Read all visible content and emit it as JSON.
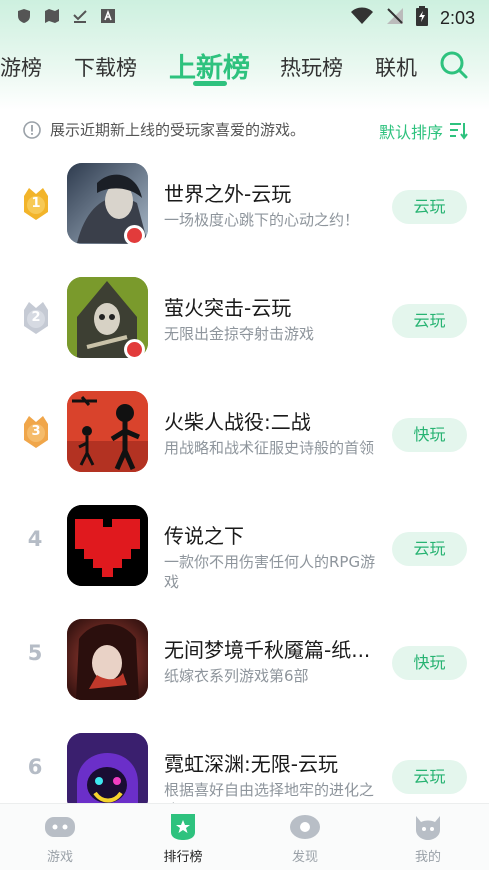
{
  "status_bar": {
    "time": "2:03"
  },
  "tabs": [
    {
      "label": "游榜"
    },
    {
      "label": "下载榜"
    },
    {
      "label": "上新榜"
    },
    {
      "label": "热玩榜"
    },
    {
      "label": "联机"
    }
  ],
  "notice": {
    "text": "展示近期新上线的受玩家喜爱的游戏。"
  },
  "sort": {
    "label": "默认排序"
  },
  "games": [
    {
      "rank": "1",
      "title": "世界之外-云玩",
      "desc": "一场极度心跳下的心动之约！",
      "action": "云玩"
    },
    {
      "rank": "2",
      "title": "萤火突击-云玩",
      "desc": "无限出金掠夺射击游戏",
      "action": "云玩"
    },
    {
      "rank": "3",
      "title": "火柴人战役:二战",
      "desc": "用战略和战术征服史诗般的首领",
      "action": "快玩"
    },
    {
      "rank": "4",
      "title": "传说之下",
      "desc": "一款你不用伤害任何人的RPG游戏",
      "action": "云玩"
    },
    {
      "rank": "5",
      "title": "无间梦境千秋魇篇-纸...",
      "desc": "纸嫁衣系列游戏第6部",
      "action": "快玩"
    },
    {
      "rank": "6",
      "title": "霓虹深渊:无限-云玩",
      "desc": "根据喜好自由选择地牢的进化之路~",
      "action": "云玩"
    }
  ],
  "bottom_nav": [
    {
      "label": "游戏"
    },
    {
      "label": "排行榜"
    },
    {
      "label": "发现"
    },
    {
      "label": "我的"
    }
  ],
  "colors": {
    "accent": "#2ec27e",
    "button_bg": "#e4f6ed",
    "rank_gray": "#b5bcc6",
    "medal_gold": "#f2b42a",
    "medal_silver": "#c5cad4",
    "medal_bronze": "#f0a64a"
  }
}
